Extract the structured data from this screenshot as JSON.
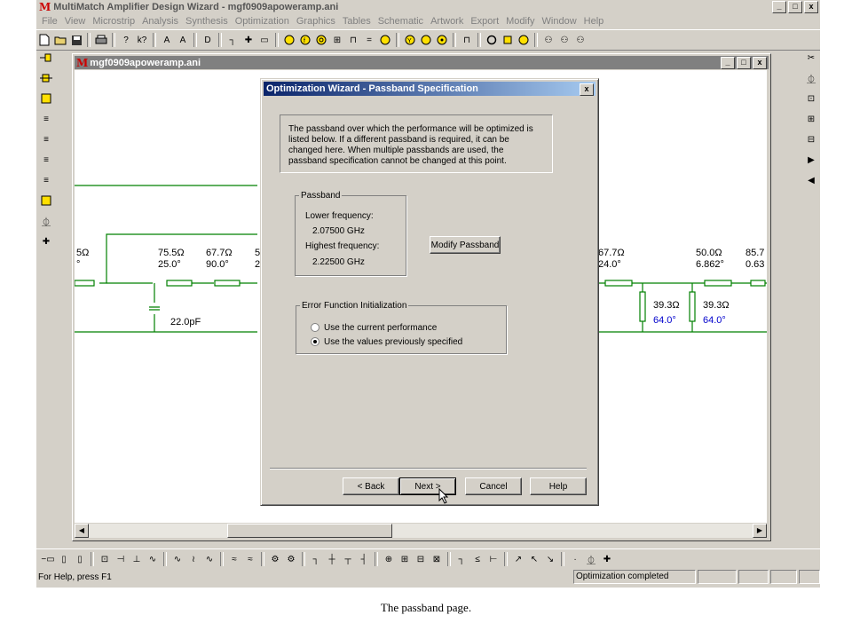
{
  "app": {
    "title": "MultiMatch Amplifier Design Wizard - mgf0909apoweramp.ani",
    "logo": "M",
    "window_controls": [
      "_",
      "□",
      "x"
    ]
  },
  "menu": [
    "File",
    "View",
    "Microstrip",
    "Analysis",
    "Synthesis",
    "Optimization",
    "Graphics",
    "Tables",
    "Schematic",
    "Artwork",
    "Export",
    "Modify",
    "Window",
    "Help"
  ],
  "doc": {
    "title": "mgf0909apoweramp.ani",
    "controls": [
      "_",
      "□",
      "x"
    ]
  },
  "schematic": {
    "labels": [
      {
        "a": "5Ω",
        "b": "°"
      },
      {
        "a": "75.5Ω",
        "b": "25.0°"
      },
      {
        "a": "67.7Ω",
        "b": "90.0°"
      },
      {
        "a": "5",
        "b": "2"
      },
      {
        "a": "67.7Ω",
        "b": "24.0°"
      },
      {
        "a": "50.0Ω",
        "b": "6.862°"
      },
      {
        "a": "85.7",
        "b": "0.63"
      }
    ],
    "cap": "22.0pF",
    "stubs": [
      {
        "a": "39.3Ω",
        "b": "64.0°"
      },
      {
        "a": "39.3Ω",
        "b": "64.0°"
      }
    ],
    "wire_color": "#008000",
    "stub_color": "#0000cc"
  },
  "dialog": {
    "title": "Optimization Wizard - Passband Specification",
    "close": "x",
    "info": "The passband over which the performance will be optimized is listed below. If a different passband is required, it can be changed here. When multiple passbands are used, the passband specification cannot be changed at this point.",
    "passband": {
      "legend": "Passband",
      "lower_label": "Lower frequency:",
      "lower_value": "2.07500 GHz",
      "high_label": "Highest frequency:",
      "high_value": "2.22500 GHz"
    },
    "modify_button": "Modify Passband",
    "error_init": {
      "legend": "Error Function Initialization",
      "options": [
        {
          "label": "Use the current performance",
          "selected": false
        },
        {
          "label": "Use the values previously specified",
          "selected": true
        }
      ]
    },
    "buttons": {
      "back": "< Back",
      "next": "Next >",
      "cancel": "Cancel",
      "help": "Help"
    }
  },
  "status": {
    "help": "For Help, press F1",
    "message": "Optimization completed"
  },
  "caption": "The passband page."
}
